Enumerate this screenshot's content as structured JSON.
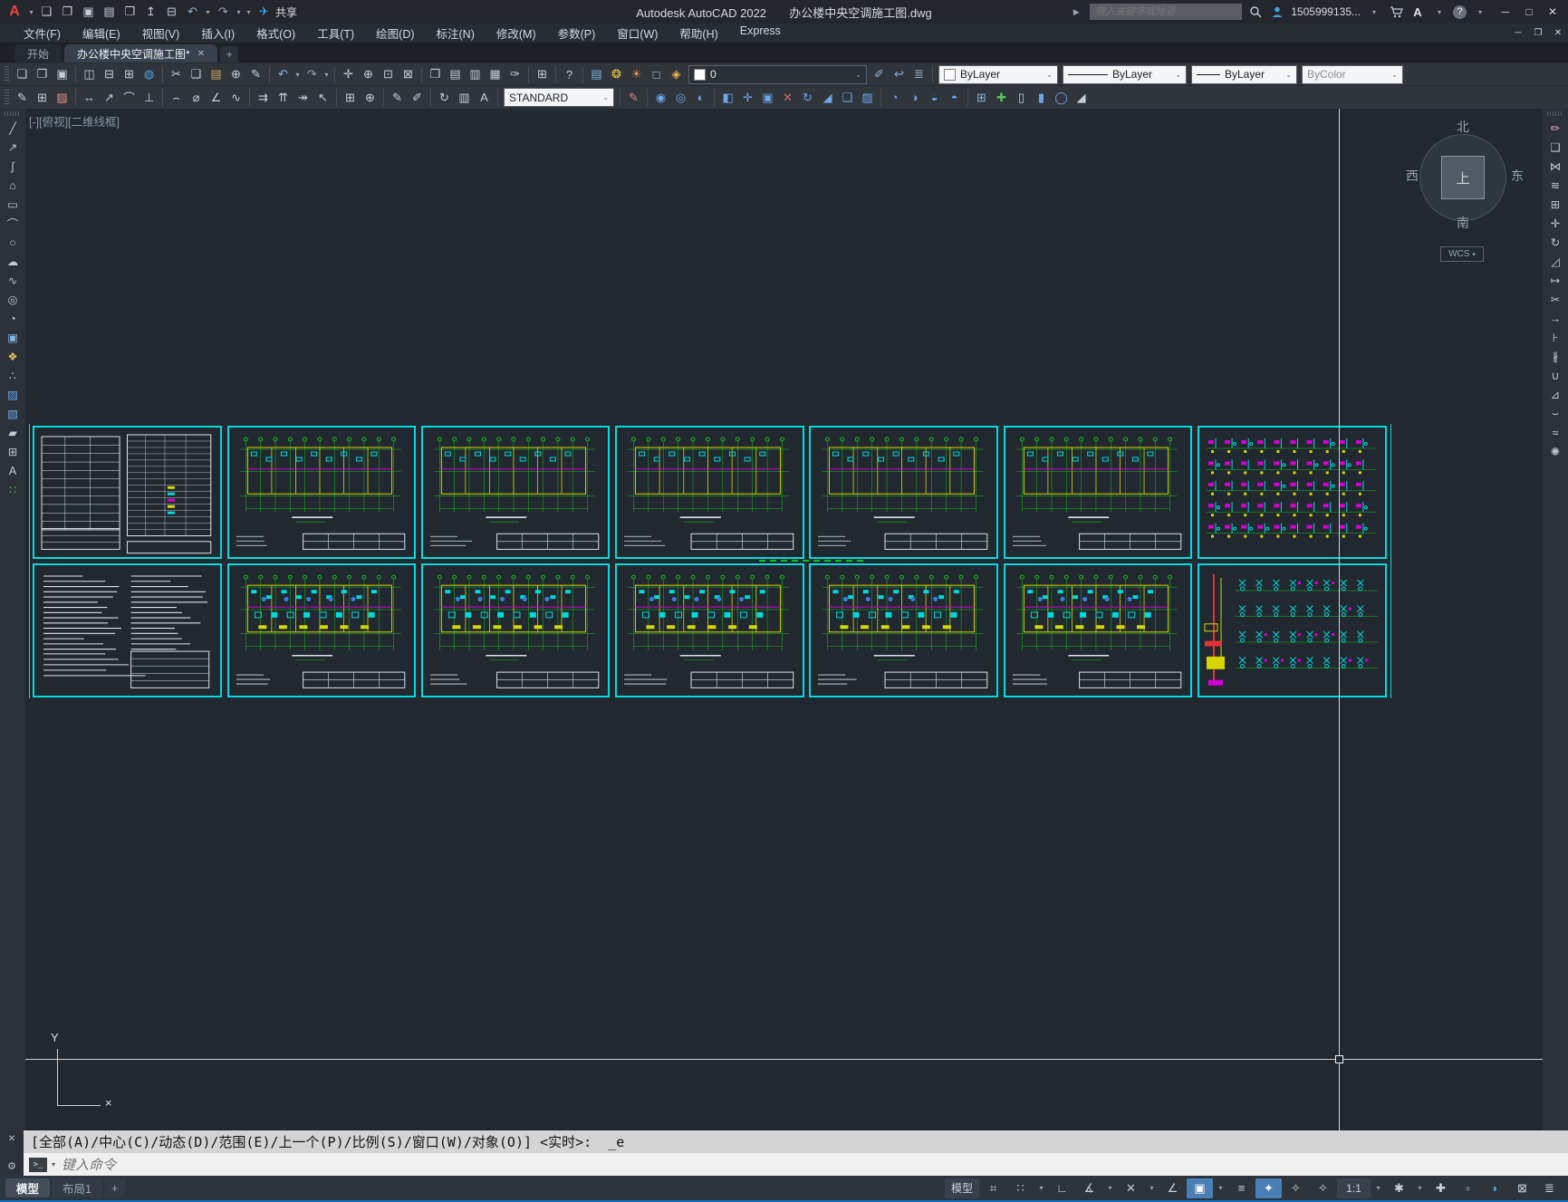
{
  "window": {
    "app_title": "Autodesk AutoCAD 2022",
    "doc_title": "办公楼中央空调施工图.dwg",
    "share_label": "共享",
    "search_placeholder": "键入关键字或短语",
    "user_name": "1505999135...",
    "store_letter": "A",
    "help_mark": "?",
    "quick_access": [
      {
        "n": "app-button",
        "g": "A",
        "cls": "logo"
      },
      {
        "n": "app-menu",
        "g": "▾",
        "caret": 1
      },
      {
        "n": "qnew",
        "g": "❏"
      },
      {
        "n": "qopen",
        "g": "❐"
      },
      {
        "n": "qsave",
        "g": "▣"
      },
      {
        "n": "qsaveas",
        "g": "▤"
      },
      {
        "n": "open-from-web",
        "g": "❒"
      },
      {
        "n": "save-to-web",
        "g": "↥"
      },
      {
        "n": "plot",
        "g": "⊟"
      },
      {
        "n": "undo",
        "g": "↶",
        "c": "#8fb0dc"
      },
      {
        "n": "undo-menu",
        "g": "▾",
        "caret": 1
      },
      {
        "n": "redo",
        "g": "↷",
        "c": "#9aa5b1"
      },
      {
        "n": "redo-menu",
        "g": "▾",
        "caret": 1
      },
      {
        "n": "qat-customize",
        "g": "▾",
        "caret": 1
      },
      {
        "n": "share",
        "g": "✈",
        "c": "#42a5f5"
      }
    ],
    "controls": [
      {
        "n": "minimize",
        "g": "─"
      },
      {
        "n": "maximize",
        "g": "□"
      },
      {
        "n": "close",
        "g": "✕"
      }
    ],
    "doc_controls": [
      {
        "n": "doc-minimize",
        "g": "─"
      },
      {
        "n": "doc-restore",
        "g": "❐"
      },
      {
        "n": "doc-close",
        "g": "✕"
      }
    ]
  },
  "menu": {
    "items": [
      "文件(F)",
      "编辑(E)",
      "视图(V)",
      "插入(I)",
      "格式(O)",
      "工具(T)",
      "绘图(D)",
      "标注(N)",
      "修改(M)",
      "参数(P)",
      "窗口(W)",
      "帮助(H)",
      "Express"
    ]
  },
  "file_tabs": {
    "start_label": "开始",
    "active_label": "办公楼中央空调施工图*",
    "close_glyph": "✕",
    "add_glyph": "+"
  },
  "toolbar1": {
    "groups": [
      [
        {
          "n": "new",
          "g": "❏"
        },
        {
          "n": "open",
          "g": "❐"
        },
        {
          "n": "save",
          "g": "▣"
        }
      ],
      [
        {
          "n": "plot-preview",
          "g": "◫"
        },
        {
          "n": "plot",
          "g": "⊟"
        },
        {
          "n": "publish",
          "g": "⊞"
        },
        {
          "n": "etransmit",
          "g": "◍",
          "c": "#4aa3e0"
        }
      ],
      [
        {
          "n": "cut",
          "g": "✂"
        },
        {
          "n": "copy-clip",
          "g": "❑"
        },
        {
          "n": "paste",
          "g": "▤",
          "c": "#cfa35f"
        },
        {
          "n": "copy-base",
          "g": "⊕"
        },
        {
          "n": "match-properties",
          "g": "✎"
        }
      ],
      [
        {
          "n": "undo",
          "g": "↶",
          "c": "#8fb0dc"
        },
        {
          "n": "undo-list",
          "g": "▾",
          "caret": 1
        },
        {
          "n": "redo",
          "g": "↷",
          "c": "#9aa5b1"
        },
        {
          "n": "redo-list",
          "g": "▾",
          "caret": 1
        }
      ],
      [
        {
          "n": "pan",
          "g": "✛"
        },
        {
          "n": "zoom-realtime",
          "g": "⊕"
        },
        {
          "n": "zoom-window",
          "g": "⊡"
        },
        {
          "n": "zoom-previous",
          "g": "⊠"
        }
      ],
      [
        {
          "n": "properties",
          "g": "❒"
        },
        {
          "n": "designcenter",
          "g": "▤"
        },
        {
          "n": "tool-palettes",
          "g": "▥"
        },
        {
          "n": "sheet-set-manager",
          "g": "▦"
        },
        {
          "n": "markup-import",
          "g": "✑"
        }
      ],
      [
        {
          "n": "quickcalc",
          "g": "⊞"
        }
      ],
      [
        {
          "n": "help",
          "g": "?"
        }
      ],
      [
        {
          "n": "layer-properties",
          "g": "▤",
          "c": "#7fb3e0"
        },
        {
          "n": "layer-on-off",
          "g": "❂",
          "c": "#f5c542"
        },
        {
          "n": "layer-thaw",
          "g": "☀",
          "c": "#f08a3c"
        },
        {
          "n": "layer-isolate",
          "g": "□"
        },
        {
          "n": "layer-lock",
          "g": "◈",
          "c": "#f0b050"
        }
      ]
    ],
    "layer_value": "0",
    "after_layer": [
      {
        "n": "make-object-layer-current",
        "g": "✐",
        "c": "#7fb3e0"
      },
      {
        "n": "layer-previous",
        "g": "↩",
        "c": "#8fb0dc"
      },
      {
        "n": "layer-states",
        "g": "≣",
        "c": "#9ab0c4"
      }
    ],
    "color_value": "ByLayer",
    "linetype_value": "ByLayer",
    "lineweight_value": "ByLayer",
    "plotstyle_value": "ByColor"
  },
  "toolbar2": {
    "groups_a": [
      [
        {
          "n": "mtext-edit",
          "g": "✎"
        },
        {
          "n": "table",
          "g": "⊞"
        },
        {
          "n": "layer-translucency",
          "g": "▨",
          "c": "#e08a8a"
        }
      ],
      [
        {
          "n": "dim-linear",
          "g": "↔"
        },
        {
          "n": "dim-aligned",
          "g": "↗"
        },
        {
          "n": "dim-arc-length",
          "g": "⌒"
        },
        {
          "n": "dim-ordinate",
          "g": "⊥"
        }
      ],
      [
        {
          "n": "dim-radius",
          "g": "⌢"
        },
        {
          "n": "dim-diameter",
          "g": "⌀"
        },
        {
          "n": "dim-angular",
          "g": "∠"
        },
        {
          "n": "dim-jogged",
          "g": "∿"
        }
      ],
      [
        {
          "n": "quick-dim",
          "g": "⇉"
        },
        {
          "n": "dim-baseline",
          "g": "⇈"
        },
        {
          "n": "dim-continue",
          "g": "↠"
        },
        {
          "n": "multileader",
          "g": "↖"
        }
      ],
      [
        {
          "n": "tolerance",
          "g": "⊞"
        },
        {
          "n": "center-mark",
          "g": "⊕"
        }
      ],
      [
        {
          "n": "dim-edit",
          "g": "✎"
        },
        {
          "n": "dim-text-edit",
          "g": "✐"
        }
      ],
      [
        {
          "n": "dim-update",
          "g": "↻"
        },
        {
          "n": "dim-style-compare",
          "g": "▥"
        },
        {
          "n": "dim-text-style",
          "g": "A"
        }
      ]
    ],
    "dimstyle_value": "STANDARD",
    "groups_b": [
      [
        {
          "n": "match-brush",
          "g": "✎",
          "c": "#d08888"
        }
      ],
      [
        {
          "n": "union",
          "g": "◉",
          "c": "#6aa6e8"
        },
        {
          "n": "subtract",
          "g": "◎",
          "c": "#6aa6e8"
        },
        {
          "n": "intersect",
          "g": "◐",
          "c": "#6aa6e8"
        }
      ],
      [
        {
          "n": "extrude-faces",
          "g": "◧",
          "c": "#6aa6e8"
        },
        {
          "n": "move-faces",
          "g": "✛",
          "c": "#6aa6e8"
        },
        {
          "n": "offset-faces",
          "g": "▣",
          "c": "#6aa6e8"
        },
        {
          "n": "delete-faces",
          "g": "✕",
          "c": "#d06a6a"
        },
        {
          "n": "rotate-faces",
          "g": "↻",
          "c": "#6aa6e8"
        },
        {
          "n": "taper-faces",
          "g": "◢",
          "c": "#6aa6e8"
        },
        {
          "n": "copy-faces",
          "g": "❑",
          "c": "#6aa6e8"
        },
        {
          "n": "color-faces",
          "g": "▨",
          "c": "#6aa6e8"
        }
      ],
      [
        {
          "n": "slice",
          "g": "◔",
          "c": "#6aa6e8"
        },
        {
          "n": "thicken",
          "g": "◑",
          "c": "#6aa6e8"
        },
        {
          "n": "interfere",
          "g": "◒",
          "c": "#6aa6e8"
        },
        {
          "n": "presspull",
          "g": "◓",
          "c": "#6aa6e8"
        }
      ],
      [
        {
          "n": "draworder",
          "g": "⊞",
          "c": "#7fb3e0"
        },
        {
          "n": "add-selected",
          "g": "✚",
          "c": "#58c060"
        },
        {
          "n": "box",
          "g": "▯"
        },
        {
          "n": "cylinder",
          "g": "▮",
          "c": "#6aa6e8"
        },
        {
          "n": "sphere",
          "g": "◯",
          "c": "#6aa6e8"
        },
        {
          "n": "wedge",
          "g": "◢"
        }
      ]
    ]
  },
  "left_toolbar": {
    "icons": [
      {
        "n": "line",
        "g": "╱"
      },
      {
        "n": "construction-line",
        "g": "↗"
      },
      {
        "n": "polyline",
        "g": "ʃ"
      },
      {
        "n": "polygon",
        "g": "⌂"
      },
      {
        "n": "rectangle",
        "g": "▭"
      },
      {
        "n": "arc",
        "g": "⌒"
      },
      {
        "n": "circle",
        "g": "○"
      },
      {
        "n": "revision-cloud",
        "g": "☁"
      },
      {
        "n": "spline",
        "g": "∿"
      },
      {
        "n": "ellipse",
        "g": "◎"
      },
      {
        "n": "ellipse-arc",
        "g": "◔"
      },
      {
        "n": "insert-block",
        "g": "▣",
        "c": "#7fb3e0"
      },
      {
        "n": "make-block",
        "g": "❖",
        "c": "#e0c060"
      },
      {
        "n": "point",
        "g": "∴"
      },
      {
        "n": "hatch",
        "g": "▨",
        "c": "#6aa6e8"
      },
      {
        "n": "gradient",
        "g": "▧",
        "c": "#6aa6e8"
      },
      {
        "n": "region",
        "g": "▰"
      },
      {
        "n": "table",
        "g": "⊞"
      },
      {
        "n": "mtext",
        "g": "A"
      },
      {
        "n": "multiple-points",
        "g": "∷",
        "c": "#58c060"
      }
    ]
  },
  "right_toolbar": {
    "icons": [
      {
        "n": "erase",
        "g": "✏",
        "c": "#e0a0b0"
      },
      {
        "n": "copy",
        "g": "❑"
      },
      {
        "n": "mirror",
        "g": "⋈"
      },
      {
        "n": "offset",
        "g": "≋"
      },
      {
        "n": "array",
        "g": "⊞"
      },
      {
        "n": "move",
        "g": "✛"
      },
      {
        "n": "rotate",
        "g": "↻"
      },
      {
        "n": "scale",
        "g": "◿"
      },
      {
        "n": "stretch",
        "g": "↦"
      },
      {
        "n": "trim",
        "g": "✂"
      },
      {
        "n": "extend",
        "g": "→"
      },
      {
        "n": "break-at-point",
        "g": "⊦"
      },
      {
        "n": "break",
        "g": "∦"
      },
      {
        "n": "join",
        "g": "∪"
      },
      {
        "n": "chamfer",
        "g": "⊿"
      },
      {
        "n": "fillet",
        "g": "⌣"
      },
      {
        "n": "blend-curves",
        "g": "≈"
      },
      {
        "n": "explode",
        "g": "✺"
      }
    ]
  },
  "canvas": {
    "viewport_label": "[-][俯视][二维线框]",
    "compass": {
      "north": "北",
      "south": "南",
      "east": "东",
      "west": "西",
      "top": "上",
      "wcs": "WCS",
      "wcs_caret": "▾"
    },
    "ucs": {
      "y_label": "Y",
      "x_label": "×"
    },
    "sheets": [
      {
        "name": "sheet-01",
        "type": "cover"
      },
      {
        "name": "sheet-02",
        "type": "plan"
      },
      {
        "name": "sheet-03",
        "type": "plan"
      },
      {
        "name": "sheet-04",
        "type": "plan"
      },
      {
        "name": "sheet-05",
        "type": "plan"
      },
      {
        "name": "sheet-06",
        "type": "plan"
      },
      {
        "name": "sheet-07",
        "type": "piping"
      },
      {
        "name": "sheet-08",
        "type": "notes"
      },
      {
        "name": "sheet-09",
        "type": "plan2"
      },
      {
        "name": "sheet-10",
        "type": "plan2"
      },
      {
        "name": "sheet-11",
        "type": "plan2"
      },
      {
        "name": "sheet-12",
        "type": "plan2"
      },
      {
        "name": "sheet-13",
        "type": "plan2"
      },
      {
        "name": "sheet-14",
        "type": "riser"
      }
    ]
  },
  "command": {
    "history": "[全部(A)/中心(C)/动态(D)/范围(E)/上一个(P)/比例(S)/窗口(W)/对象(O)] <实时>:  _e",
    "input_placeholder": "键入命令",
    "close_glyph": "✕",
    "wrench_glyph": "⚙",
    "prompt_glyph": ">_"
  },
  "status_bar": {
    "layout_tabs": [
      {
        "label": "模型",
        "active": 1,
        "n": "model-tab"
      },
      {
        "label": "布局1",
        "n": "layout1-tab"
      },
      {
        "label": "+",
        "n": "new-layout-tab",
        "add": 1
      }
    ],
    "right_items": [
      {
        "n": "model-paper-toggle",
        "label": "模型",
        "text": 1
      },
      {
        "n": "grid-display",
        "g": "⌗"
      },
      {
        "n": "snap-mode",
        "g": "∷"
      },
      {
        "n": "snap-menu",
        "g": "▾",
        "caret": 1
      },
      {
        "n": "ortho-mode",
        "g": "∟"
      },
      {
        "n": "polar-tracking",
        "g": "∡"
      },
      {
        "n": "polar-menu",
        "g": "▾",
        "caret": 1
      },
      {
        "n": "object-snap-tracking",
        "g": "✕"
      },
      {
        "n": "otrack-menu",
        "g": "▾",
        "caret": 1
      },
      {
        "n": "isometric-drafting",
        "g": "∠"
      },
      {
        "n": "object-snap",
        "g": "▣",
        "active": 1
      },
      {
        "n": "osnap-menu",
        "g": "▾",
        "caret": 1
      },
      {
        "n": "lineweight-display",
        "g": "≡"
      },
      {
        "n": "annotation-visibility",
        "g": "✦",
        "active": 1
      },
      {
        "n": "autoscale-annotations",
        "g": "✧"
      },
      {
        "n": "annotation-scale-sync",
        "g": "✧"
      },
      {
        "n": "annotation-scale",
        "label": "1:1",
        "text": 1
      },
      {
        "n": "scale-menu",
        "g": "▾",
        "caret": 1
      },
      {
        "n": "workspace-switching",
        "g": "✱"
      },
      {
        "n": "workspace-menu",
        "g": "▾",
        "caret": 1
      },
      {
        "n": "annotation-monitor",
        "g": "✚"
      },
      {
        "n": "isolate-objects",
        "g": "▫"
      },
      {
        "n": "graphics-performance",
        "g": "◗",
        "c": "#4aa3e0"
      },
      {
        "n": "clean-screen",
        "g": "⊠"
      },
      {
        "n": "customization",
        "g": "≣"
      }
    ]
  }
}
